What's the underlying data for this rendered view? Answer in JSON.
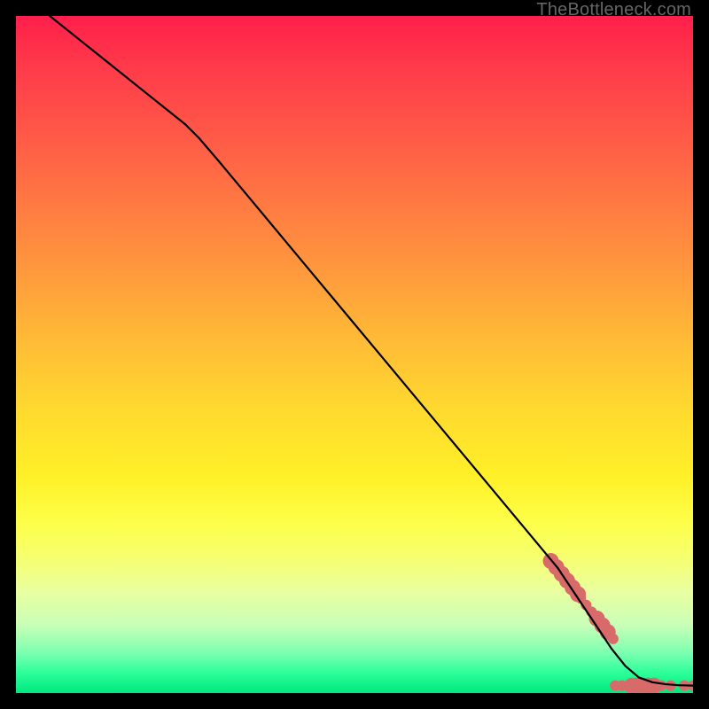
{
  "credit": "TheBottleneck.com",
  "chart_data": {
    "type": "line",
    "title": "",
    "xlabel": "",
    "ylabel": "",
    "xlim": [
      0,
      100
    ],
    "ylim": [
      0,
      100
    ],
    "series": [
      {
        "name": "curve",
        "x": [
          5,
          10,
          15,
          20,
          25,
          27,
          30,
          35,
          40,
          45,
          50,
          55,
          60,
          65,
          70,
          75,
          80,
          82,
          84,
          86,
          88,
          90,
          92,
          94,
          96,
          98,
          100
        ],
        "y": [
          100,
          96,
          92,
          88,
          84,
          82,
          78.5,
          72.5,
          66.5,
          60.5,
          54.5,
          48.5,
          42.5,
          36.5,
          30.5,
          24.5,
          18.5,
          15.5,
          12.5,
          9.5,
          6.5,
          4.0,
          2.3,
          1.6,
          1.3,
          1.15,
          1.1
        ]
      }
    ],
    "markers": {
      "name": "cluster",
      "color": "#d96a6a",
      "radius_large": 9,
      "radius_small": 6,
      "points": [
        {
          "x": 79.0,
          "y": 19.5,
          "r": "large"
        },
        {
          "x": 79.8,
          "y": 18.6,
          "r": "large"
        },
        {
          "x": 80.6,
          "y": 17.6,
          "r": "large"
        },
        {
          "x": 81.4,
          "y": 16.6,
          "r": "large"
        },
        {
          "x": 82.2,
          "y": 15.6,
          "r": "large"
        },
        {
          "x": 83.0,
          "y": 14.6,
          "r": "large"
        },
        {
          "x": 83.4,
          "y": 14.0,
          "r": "small"
        },
        {
          "x": 84.2,
          "y": 13.0,
          "r": "small"
        },
        {
          "x": 85.0,
          "y": 12.0,
          "r": "small"
        },
        {
          "x": 85.8,
          "y": 11.0,
          "r": "large"
        },
        {
          "x": 86.6,
          "y": 10.0,
          "r": "large"
        },
        {
          "x": 87.4,
          "y": 9.0,
          "r": "large"
        },
        {
          "x": 88.2,
          "y": 8.0,
          "r": "small"
        },
        {
          "x": 88.5,
          "y": 1.1,
          "r": "small"
        },
        {
          "x": 89.5,
          "y": 1.1,
          "r": "small"
        },
        {
          "x": 90.5,
          "y": 1.1,
          "r": "small"
        },
        {
          "x": 91.0,
          "y": 1.1,
          "r": "large"
        },
        {
          "x": 91.8,
          "y": 1.1,
          "r": "large"
        },
        {
          "x": 92.6,
          "y": 1.1,
          "r": "large"
        },
        {
          "x": 93.4,
          "y": 1.1,
          "r": "large"
        },
        {
          "x": 94.2,
          "y": 1.1,
          "r": "large"
        },
        {
          "x": 95.3,
          "y": 1.1,
          "r": "small"
        },
        {
          "x": 96.7,
          "y": 1.1,
          "r": "small"
        },
        {
          "x": 98.7,
          "y": 1.1,
          "r": "small"
        },
        {
          "x": 100.0,
          "y": 1.1,
          "r": "small"
        }
      ]
    }
  }
}
